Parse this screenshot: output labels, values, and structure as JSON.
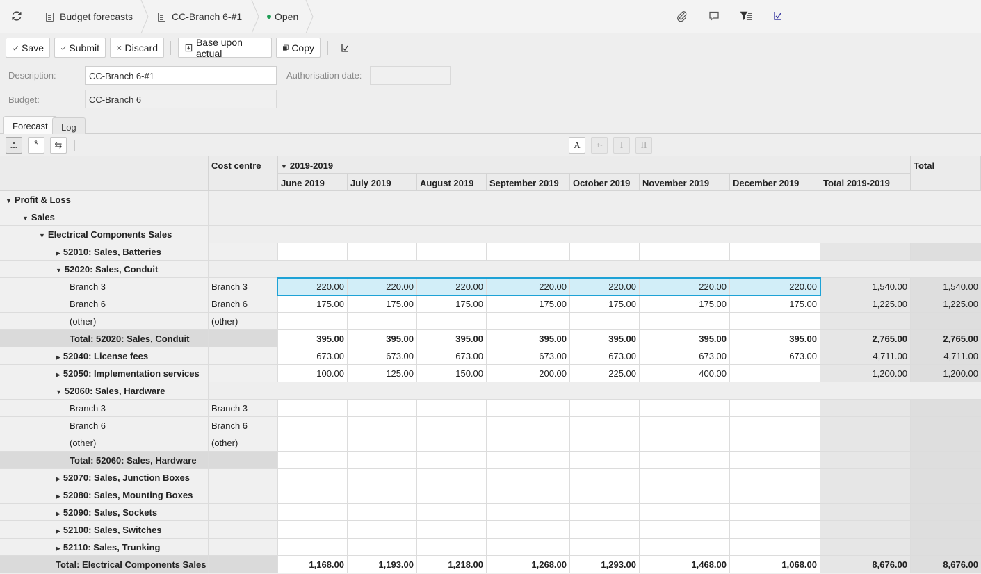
{
  "breadcrumb": {
    "module": "Budget forecasts",
    "record": "CC-Branch 6-#1",
    "status": "Open",
    "status_color": "#1f9d55"
  },
  "toolbar": {
    "save": "Save",
    "submit": "Submit",
    "discard": "Discard",
    "base_upon_actual": "Base upon actual",
    "copy": "Copy"
  },
  "form": {
    "description_label": "Description:",
    "description_value": "CC-Branch 6-#1",
    "authorisation_label": "Authorisation date:",
    "authorisation_value": "",
    "budget_label": "Budget:",
    "budget_value": "CC-Branch 6"
  },
  "tabs": [
    "Forecast",
    "Log"
  ],
  "gridbar": {
    "font_btn": "A",
    "tally_btn": "+-",
    "single_btn": "I",
    "double_btn": "II",
    "star_btn": "*",
    "swap_btn": "⇆"
  },
  "grid": {
    "cost_centre_header": "Cost centre",
    "period_group": "2019-2019",
    "months": [
      "June 2019",
      "July 2019",
      "August 2019",
      "September 2019",
      "October 2019",
      "November 2019",
      "December 2019"
    ],
    "period_total": "Total 2019-2019",
    "total_header": "Total",
    "rows": [
      {
        "label": "Profit & Loss",
        "cc": "",
        "vals": [],
        "ptot": "",
        "tot": "",
        "kind": "group",
        "indent": 0,
        "tri": "down"
      },
      {
        "label": "Sales",
        "cc": "",
        "vals": [],
        "ptot": "",
        "tot": "",
        "kind": "group",
        "indent": 1,
        "tri": "down"
      },
      {
        "label": "Electrical Components Sales",
        "cc": "",
        "vals": [],
        "ptot": "",
        "tot": "",
        "kind": "group",
        "indent": 2,
        "tri": "down"
      },
      {
        "label": "52010: Sales, Batteries",
        "cc": "",
        "vals": [
          "",
          "",
          "",
          "",
          "",
          "",
          ""
        ],
        "ptot": "",
        "tot": "",
        "kind": "acct",
        "indent": 3,
        "tri": "right"
      },
      {
        "label": "52020: Sales, Conduit",
        "cc": "",
        "vals": [],
        "ptot": "",
        "tot": "",
        "kind": "group",
        "indent": 3,
        "tri": "down"
      },
      {
        "label": "Branch 3",
        "cc": "Branch 3",
        "vals": [
          "220.00",
          "220.00",
          "220.00",
          "220.00",
          "220.00",
          "220.00",
          "220.00"
        ],
        "ptot": "1,540.00",
        "tot": "1,540.00",
        "kind": "sub",
        "indent": 4,
        "tri": "",
        "selected": true
      },
      {
        "label": "Branch 6",
        "cc": "Branch 6",
        "vals": [
          "175.00",
          "175.00",
          "175.00",
          "175.00",
          "175.00",
          "175.00",
          "175.00"
        ],
        "ptot": "1,225.00",
        "tot": "1,225.00",
        "kind": "sub",
        "indent": 4,
        "tri": ""
      },
      {
        "label": "(other)",
        "cc": "(other)",
        "vals": [
          "",
          "",
          "",
          "",
          "",
          "",
          ""
        ],
        "ptot": "",
        "tot": "",
        "kind": "sub",
        "indent": 4,
        "tri": ""
      },
      {
        "label": "Total: 52020: Sales, Conduit",
        "cc": "",
        "vals": [
          "395.00",
          "395.00",
          "395.00",
          "395.00",
          "395.00",
          "395.00",
          "395.00"
        ],
        "ptot": "2,765.00",
        "tot": "2,765.00",
        "kind": "total",
        "indent": 4,
        "tri": ""
      },
      {
        "label": "52040: License fees",
        "cc": "",
        "vals": [
          "673.00",
          "673.00",
          "673.00",
          "673.00",
          "673.00",
          "673.00",
          "673.00"
        ],
        "ptot": "4,711.00",
        "tot": "4,711.00",
        "kind": "acct",
        "indent": 3,
        "tri": "right"
      },
      {
        "label": "52050: Implementation services",
        "cc": "",
        "vals": [
          "100.00",
          "125.00",
          "150.00",
          "200.00",
          "225.00",
          "400.00",
          ""
        ],
        "ptot": "1,200.00",
        "tot": "1,200.00",
        "kind": "acct",
        "indent": 3,
        "tri": "right"
      },
      {
        "label": "52060: Sales, Hardware",
        "cc": "",
        "vals": [],
        "ptot": "",
        "tot": "",
        "kind": "group",
        "indent": 3,
        "tri": "down"
      },
      {
        "label": "Branch 3",
        "cc": "Branch 3",
        "vals": [
          "",
          "",
          "",
          "",
          "",
          "",
          ""
        ],
        "ptot": "",
        "tot": "",
        "kind": "sub",
        "indent": 4,
        "tri": ""
      },
      {
        "label": "Branch 6",
        "cc": "Branch 6",
        "vals": [
          "",
          "",
          "",
          "",
          "",
          "",
          ""
        ],
        "ptot": "",
        "tot": "",
        "kind": "sub",
        "indent": 4,
        "tri": ""
      },
      {
        "label": "(other)",
        "cc": "(other)",
        "vals": [
          "",
          "",
          "",
          "",
          "",
          "",
          ""
        ],
        "ptot": "",
        "tot": "",
        "kind": "sub",
        "indent": 4,
        "tri": ""
      },
      {
        "label": "Total: 52060: Sales, Hardware",
        "cc": "",
        "vals": [
          "",
          "",
          "",
          "",
          "",
          "",
          ""
        ],
        "ptot": "",
        "tot": "",
        "kind": "total",
        "indent": 4,
        "tri": ""
      },
      {
        "label": "52070: Sales, Junction Boxes",
        "cc": "",
        "vals": [
          "",
          "",
          "",
          "",
          "",
          "",
          ""
        ],
        "ptot": "",
        "tot": "",
        "kind": "acct",
        "indent": 3,
        "tri": "right"
      },
      {
        "label": "52080: Sales, Mounting Boxes",
        "cc": "",
        "vals": [
          "",
          "",
          "",
          "",
          "",
          "",
          ""
        ],
        "ptot": "",
        "tot": "",
        "kind": "acct",
        "indent": 3,
        "tri": "right"
      },
      {
        "label": "52090: Sales, Sockets",
        "cc": "",
        "vals": [
          "",
          "",
          "",
          "",
          "",
          "",
          ""
        ],
        "ptot": "",
        "tot": "",
        "kind": "acct",
        "indent": 3,
        "tri": "right"
      },
      {
        "label": "52100: Sales, Switches",
        "cc": "",
        "vals": [
          "",
          "",
          "",
          "",
          "",
          "",
          ""
        ],
        "ptot": "",
        "tot": "",
        "kind": "acct",
        "indent": 3,
        "tri": "right"
      },
      {
        "label": "52110: Sales, Trunking",
        "cc": "",
        "vals": [
          "",
          "",
          "",
          "",
          "",
          "",
          ""
        ],
        "ptot": "",
        "tot": "",
        "kind": "acct",
        "indent": 3,
        "tri": "right"
      },
      {
        "label": "Total: Electrical Components Sales",
        "cc": "",
        "vals": [
          "1,168.00",
          "1,193.00",
          "1,218.00",
          "1,268.00",
          "1,293.00",
          "1,468.00",
          "1,068.00"
        ],
        "ptot": "8,676.00",
        "tot": "8,676.00",
        "kind": "total",
        "indent": 3,
        "tri": ""
      }
    ]
  }
}
